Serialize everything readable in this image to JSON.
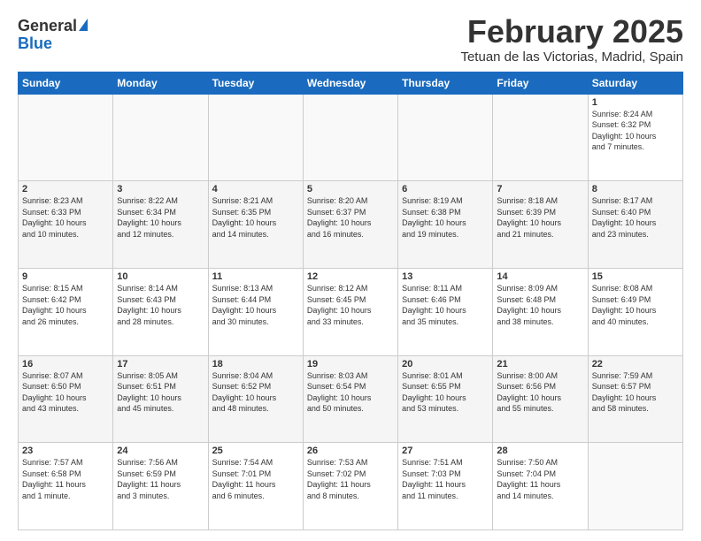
{
  "logo": {
    "general": "General",
    "blue": "Blue"
  },
  "header": {
    "month": "February 2025",
    "location": "Tetuan de las Victorias, Madrid, Spain"
  },
  "days_of_week": [
    "Sunday",
    "Monday",
    "Tuesday",
    "Wednesday",
    "Thursday",
    "Friday",
    "Saturday"
  ],
  "weeks": [
    [
      {
        "day": "",
        "info": ""
      },
      {
        "day": "",
        "info": ""
      },
      {
        "day": "",
        "info": ""
      },
      {
        "day": "",
        "info": ""
      },
      {
        "day": "",
        "info": ""
      },
      {
        "day": "",
        "info": ""
      },
      {
        "day": "1",
        "info": "Sunrise: 8:24 AM\nSunset: 6:32 PM\nDaylight: 10 hours\nand 7 minutes."
      }
    ],
    [
      {
        "day": "2",
        "info": "Sunrise: 8:23 AM\nSunset: 6:33 PM\nDaylight: 10 hours\nand 10 minutes."
      },
      {
        "day": "3",
        "info": "Sunrise: 8:22 AM\nSunset: 6:34 PM\nDaylight: 10 hours\nand 12 minutes."
      },
      {
        "day": "4",
        "info": "Sunrise: 8:21 AM\nSunset: 6:35 PM\nDaylight: 10 hours\nand 14 minutes."
      },
      {
        "day": "5",
        "info": "Sunrise: 8:20 AM\nSunset: 6:37 PM\nDaylight: 10 hours\nand 16 minutes."
      },
      {
        "day": "6",
        "info": "Sunrise: 8:19 AM\nSunset: 6:38 PM\nDaylight: 10 hours\nand 19 minutes."
      },
      {
        "day": "7",
        "info": "Sunrise: 8:18 AM\nSunset: 6:39 PM\nDaylight: 10 hours\nand 21 minutes."
      },
      {
        "day": "8",
        "info": "Sunrise: 8:17 AM\nSunset: 6:40 PM\nDaylight: 10 hours\nand 23 minutes."
      }
    ],
    [
      {
        "day": "9",
        "info": "Sunrise: 8:15 AM\nSunset: 6:42 PM\nDaylight: 10 hours\nand 26 minutes."
      },
      {
        "day": "10",
        "info": "Sunrise: 8:14 AM\nSunset: 6:43 PM\nDaylight: 10 hours\nand 28 minutes."
      },
      {
        "day": "11",
        "info": "Sunrise: 8:13 AM\nSunset: 6:44 PM\nDaylight: 10 hours\nand 30 minutes."
      },
      {
        "day": "12",
        "info": "Sunrise: 8:12 AM\nSunset: 6:45 PM\nDaylight: 10 hours\nand 33 minutes."
      },
      {
        "day": "13",
        "info": "Sunrise: 8:11 AM\nSunset: 6:46 PM\nDaylight: 10 hours\nand 35 minutes."
      },
      {
        "day": "14",
        "info": "Sunrise: 8:09 AM\nSunset: 6:48 PM\nDaylight: 10 hours\nand 38 minutes."
      },
      {
        "day": "15",
        "info": "Sunrise: 8:08 AM\nSunset: 6:49 PM\nDaylight: 10 hours\nand 40 minutes."
      }
    ],
    [
      {
        "day": "16",
        "info": "Sunrise: 8:07 AM\nSunset: 6:50 PM\nDaylight: 10 hours\nand 43 minutes."
      },
      {
        "day": "17",
        "info": "Sunrise: 8:05 AM\nSunset: 6:51 PM\nDaylight: 10 hours\nand 45 minutes."
      },
      {
        "day": "18",
        "info": "Sunrise: 8:04 AM\nSunset: 6:52 PM\nDaylight: 10 hours\nand 48 minutes."
      },
      {
        "day": "19",
        "info": "Sunrise: 8:03 AM\nSunset: 6:54 PM\nDaylight: 10 hours\nand 50 minutes."
      },
      {
        "day": "20",
        "info": "Sunrise: 8:01 AM\nSunset: 6:55 PM\nDaylight: 10 hours\nand 53 minutes."
      },
      {
        "day": "21",
        "info": "Sunrise: 8:00 AM\nSunset: 6:56 PM\nDaylight: 10 hours\nand 55 minutes."
      },
      {
        "day": "22",
        "info": "Sunrise: 7:59 AM\nSunset: 6:57 PM\nDaylight: 10 hours\nand 58 minutes."
      }
    ],
    [
      {
        "day": "23",
        "info": "Sunrise: 7:57 AM\nSunset: 6:58 PM\nDaylight: 11 hours\nand 1 minute."
      },
      {
        "day": "24",
        "info": "Sunrise: 7:56 AM\nSunset: 6:59 PM\nDaylight: 11 hours\nand 3 minutes."
      },
      {
        "day": "25",
        "info": "Sunrise: 7:54 AM\nSunset: 7:01 PM\nDaylight: 11 hours\nand 6 minutes."
      },
      {
        "day": "26",
        "info": "Sunrise: 7:53 AM\nSunset: 7:02 PM\nDaylight: 11 hours\nand 8 minutes."
      },
      {
        "day": "27",
        "info": "Sunrise: 7:51 AM\nSunset: 7:03 PM\nDaylight: 11 hours\nand 11 minutes."
      },
      {
        "day": "28",
        "info": "Sunrise: 7:50 AM\nSunset: 7:04 PM\nDaylight: 11 hours\nand 14 minutes."
      },
      {
        "day": "",
        "info": ""
      }
    ]
  ]
}
